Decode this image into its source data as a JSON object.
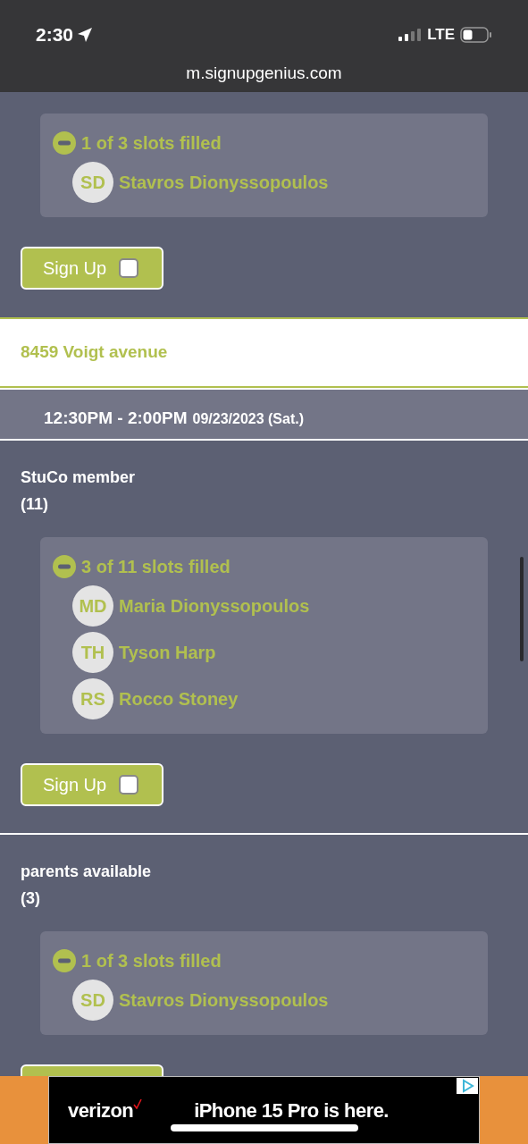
{
  "status_bar": {
    "time": "2:30",
    "network": "LTE"
  },
  "browser": {
    "url": "m.signupgenius.com"
  },
  "first_slot": {
    "slots_text": "1 of 3 slots filled",
    "signups": [
      {
        "initials": "SD",
        "name": "Stavros Dionyssopoulos"
      }
    ],
    "button": "Sign Up",
    "checked": false
  },
  "location": "8459 Voigt avenue",
  "time_range": {
    "time": "12:30PM - 2:00PM",
    "date": "09/23/2023 (Sat.)"
  },
  "items": [
    {
      "title": "StuCo member",
      "count": "(11)",
      "slots_text": "3 of 11 slots filled",
      "signups": [
        {
          "initials": "MD",
          "name": "Maria Dionyssopoulos"
        },
        {
          "initials": "TH",
          "name": "Tyson Harp"
        },
        {
          "initials": "RS",
          "name": "Rocco Stoney"
        }
      ],
      "button": "Sign Up",
      "checked": false
    },
    {
      "title": "parents available",
      "count": "(3)",
      "slots_text": "1 of 3 slots filled",
      "signups": [
        {
          "initials": "SD",
          "name": "Stavros Dionyssopoulos"
        }
      ]
    }
  ],
  "ad": {
    "brand": "verizon",
    "headline": "iPhone 15 Pro is here."
  }
}
